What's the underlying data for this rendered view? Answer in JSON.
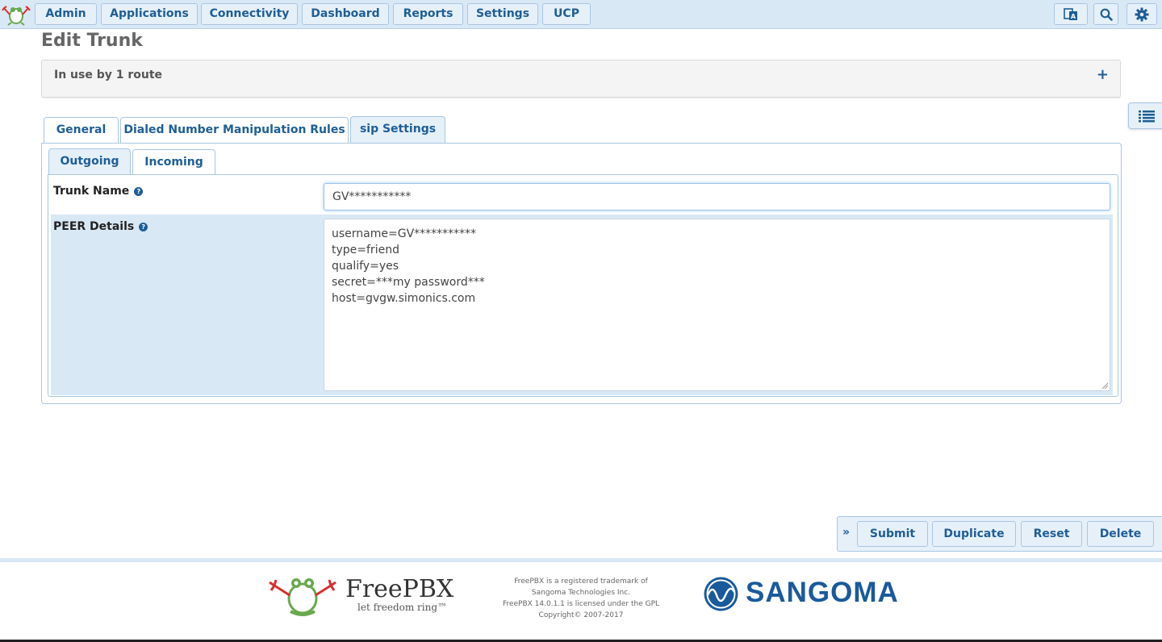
{
  "nav": {
    "items": [
      "Admin",
      "Applications",
      "Connectivity",
      "Dashboard",
      "Reports",
      "Settings",
      "UCP"
    ],
    "icons": [
      "language-icon",
      "search-icon",
      "gear-icon"
    ]
  },
  "page": {
    "title": "Edit Trunk"
  },
  "inuse": {
    "text": "In use by 1 route",
    "toggle": "+"
  },
  "tabs": [
    "General",
    "Dialed Number Manipulation Rules",
    "sip Settings"
  ],
  "subtabs": [
    "Outgoing",
    "Incoming"
  ],
  "form": {
    "trunk_name_label": "Trunk Name",
    "trunk_name_value": "GV***********",
    "peer_label": "PEER Details",
    "peer_value": "username=GV***********\ntype=friend\nqualify=yes\nsecret=***my password***\nhost=gvgw.simonics.com"
  },
  "actions": {
    "expand": "»",
    "submit": "Submit",
    "duplicate": "Duplicate",
    "reset": "Reset",
    "delete": "Delete"
  },
  "footer": {
    "brand": "FreePBX",
    "tagline": "let freedom ring™",
    "legal1": "FreePBX is a registered trademark of",
    "legal2": "Sangoma Technologies Inc.",
    "legal3": "FreePBX 14.0.1.1 is licensed under the GPL",
    "legal4": "Copyright© 2007-2017",
    "sangoma": "SANGOMA"
  },
  "colors": {
    "accent": "#1e5e96",
    "bar": "#d9e8f5"
  }
}
